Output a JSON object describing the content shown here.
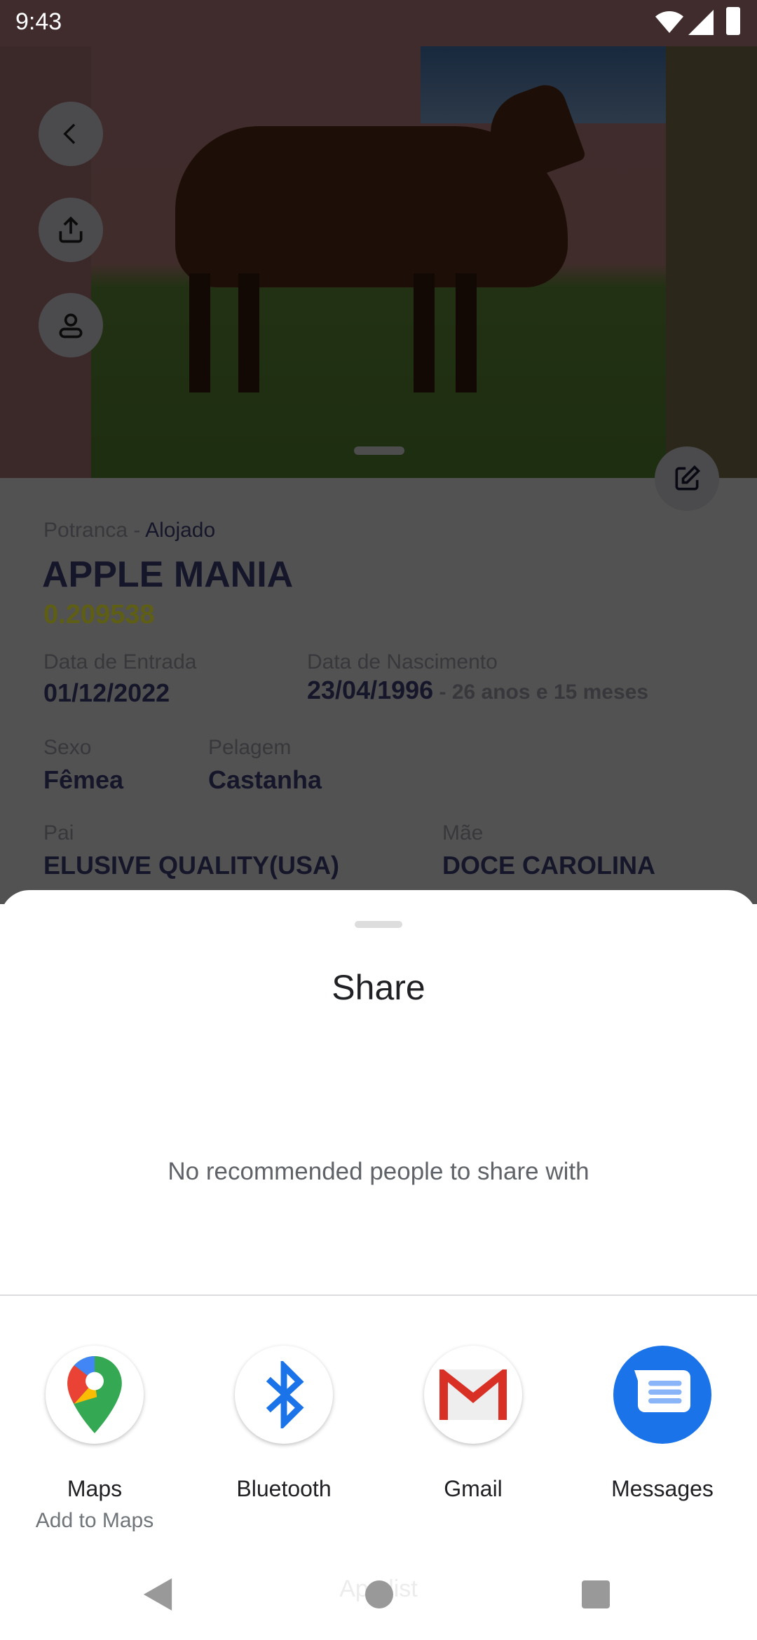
{
  "status_bar": {
    "time": "9:43"
  },
  "horse": {
    "category": "Potranca",
    "separator": " - ",
    "status": "Alojado",
    "name": "APPLE MANIA",
    "code": "0.209538",
    "entry_label": "Data de Entrada",
    "entry_value": "01/12/2022",
    "birth_label": "Data de Nascimento",
    "birth_value": "23/04/1996",
    "age": " - 26 anos e  15 meses",
    "sex_label": "Sexo",
    "sex_value": "Fêmea",
    "coat_label": "Pelagem",
    "coat_value": "Castanha",
    "sire_label": "Pai",
    "sire_value": "ELUSIVE QUALITY(USA)",
    "dam_label": "Mãe",
    "dam_value": "DOCE CAROLINA"
  },
  "share_sheet": {
    "title": "Share",
    "empty_message": "No recommended people to share with",
    "apps": [
      {
        "label": "Maps",
        "sublabel": "Add to Maps",
        "icon": "google-maps-icon"
      },
      {
        "label": "Bluetooth",
        "icon": "bluetooth-icon"
      },
      {
        "label": "Gmail",
        "icon": "gmail-icon"
      },
      {
        "label": "Messages",
        "icon": "messages-icon"
      }
    ],
    "footer_hint": "App list"
  },
  "colors": {
    "code": "#c8c81e",
    "messages": "#1a73e8",
    "bluetooth": "#1a73e8"
  }
}
